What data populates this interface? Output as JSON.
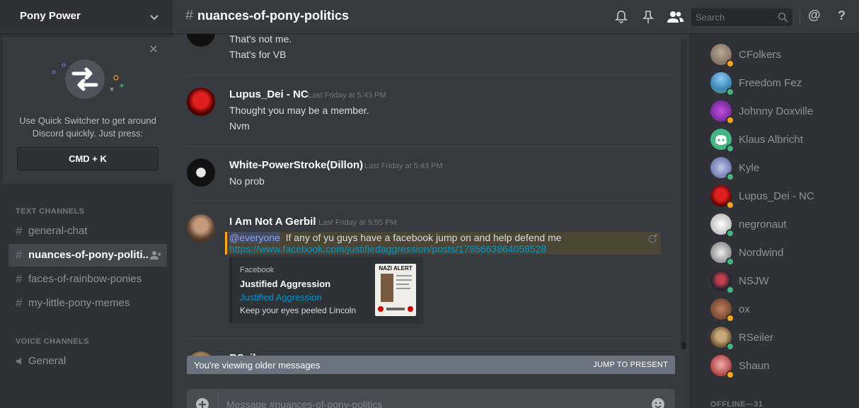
{
  "server": {
    "name": "Pony Power"
  },
  "quick_switcher": {
    "text_line1": "Use Quick Switcher to get around",
    "text_line2": "Discord quickly. Just press:",
    "shortcut": "CMD + K"
  },
  "categories": {
    "text": "TEXT CHANNELS",
    "voice": "VOICE CHANNELS"
  },
  "text_channels": [
    {
      "name": "general-chat",
      "active": false
    },
    {
      "name": "nuances-of-pony-politi...",
      "active": true
    },
    {
      "name": "faces-of-rainbow-ponies",
      "active": false
    },
    {
      "name": "my-little-pony-memes",
      "active": false
    }
  ],
  "voice_channels": [
    {
      "name": "General"
    }
  ],
  "header": {
    "channel_name": "nuances-of-pony-politics",
    "search_placeholder": "Search",
    "hash": "#",
    "at": "@",
    "help": "?"
  },
  "messages": [
    {
      "username": "",
      "timestamp": "",
      "lines": [
        "That's not me.",
        "That's for VB"
      ]
    },
    {
      "username": "Lupus_Dei - NC",
      "timestamp": "Last Friday at 5:43 PM",
      "lines": [
        "Thought you may be a member.",
        "Nvm"
      ]
    },
    {
      "username": "White-PowerStroke(Dillon)",
      "timestamp": "Last Friday at 5:43 PM",
      "lines": [
        "No prob"
      ]
    },
    {
      "username": "I Am Not A Gerbil",
      "timestamp": "Last Friday at 9:55 PM",
      "mention": "@everyone",
      "lines": [
        "If any of yu guys have a facebook jump on and help defend me"
      ],
      "link": "https://www.facebook.com/justifiedaggression/posts/1795663864058528",
      "embed": {
        "provider": "Facebook",
        "title": "Justified Aggression",
        "author": "Justified Aggression",
        "description": "Keep your eyes peeled Lincoln",
        "thumb_text": "NAZI ALERT"
      }
    },
    {
      "username": "RSeiler",
      "timestamp": "",
      "lines": []
    }
  ],
  "older_bar": {
    "text": "You're viewing older messages",
    "jump": "JUMP TO PRESENT"
  },
  "composer": {
    "placeholder": "Message #nuances-of-pony-politics"
  },
  "members": [
    {
      "name": "CFolkers",
      "status": "idle",
      "color": "#8a7a68"
    },
    {
      "name": "Freedom Fez",
      "status": "online",
      "color": "#4aa3d8"
    },
    {
      "name": "Johnny Doxville",
      "status": "idle",
      "color": "#7d2fb0"
    },
    {
      "name": "Klaus Albricht",
      "status": "online",
      "color": "#43b581"
    },
    {
      "name": "Kyle",
      "status": "online",
      "color": "#5a6fa8"
    },
    {
      "name": "Lupus_Dei - NC",
      "status": "idle",
      "color": "#b11a1a"
    },
    {
      "name": "negronaut",
      "status": "online",
      "color": "#d8d8d8"
    },
    {
      "name": "Nordwind",
      "status": "online",
      "color": "#e0e0e0"
    },
    {
      "name": "NSJW",
      "status": "online",
      "color": "#3a3440"
    },
    {
      "name": "ox",
      "status": "idle",
      "color": "#8b5a3c"
    },
    {
      "name": "RSeiler",
      "status": "online",
      "color": "#a08860"
    },
    {
      "name": "Shaun",
      "status": "idle",
      "color": "#c87070"
    }
  ],
  "offline_label": "OFFLINE—31",
  "colors": {
    "accent_online": "#43b581",
    "accent_idle": "#faa61a",
    "link": "#0096cf",
    "mention": "#8ea1e1"
  }
}
